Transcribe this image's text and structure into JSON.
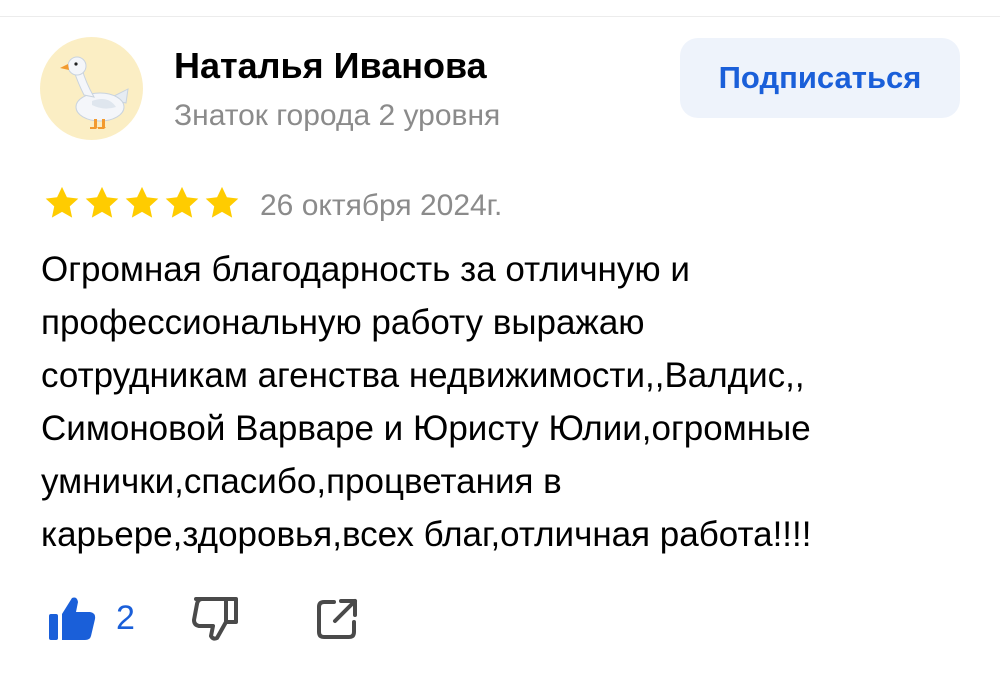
{
  "author": {
    "name": "Наталья Иванова",
    "level": "Знаток города 2 уровня",
    "avatar_icon": "goose-avatar-icon"
  },
  "subscribe_label": "Подписаться",
  "review": {
    "rating": 5,
    "rating_max": 5,
    "date": "26 октября 2024г.",
    "text": "Огромная благодарность за отличную и\nпрофессиональную работу выражаю\nсотрудникам агенства недвижимости,,Валдис,,\nСимоновой Варваре и Юристу Юлии,огромные\nумнички,спасибо,процветания в\nкарьере,здоровья,всех благ,отличная работа!!!!"
  },
  "actions": {
    "like_count": "2",
    "like_icon": "thumbs-up-icon",
    "dislike_icon": "thumbs-down-icon",
    "share_icon": "share-icon"
  },
  "colors": {
    "accent": "#1a5fd9",
    "star": "#ffcc00",
    "secondary_text": "#8b8b8b",
    "button_bg": "#eef3fb",
    "avatar_bg": "#fbeec4"
  }
}
